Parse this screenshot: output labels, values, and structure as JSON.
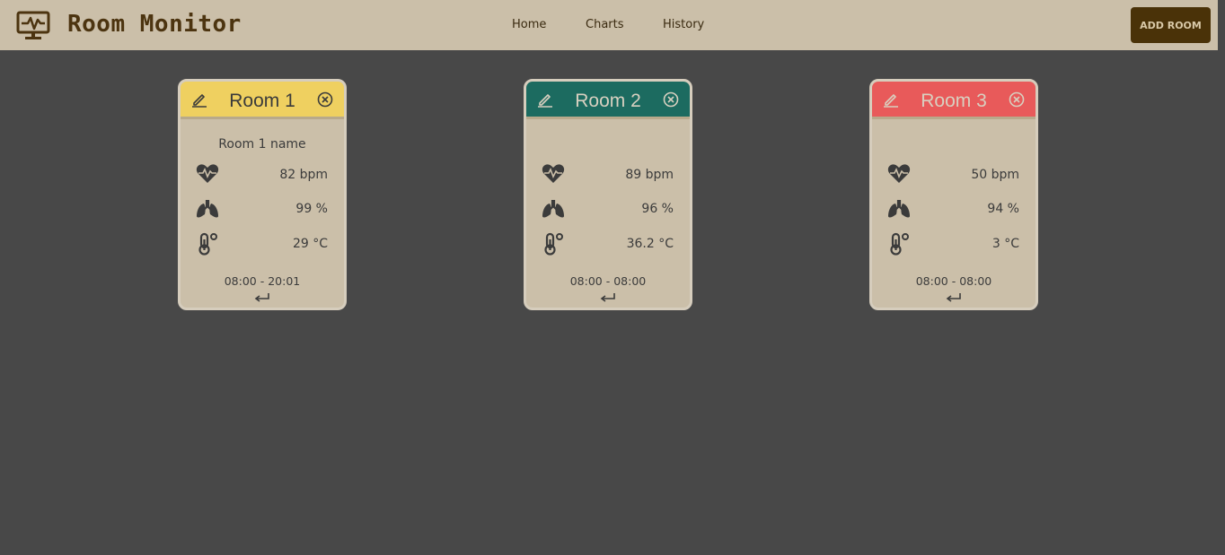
{
  "app": {
    "title": "Room Monitor",
    "logo_icon": "monitor-heartbeat-icon"
  },
  "nav": {
    "items": [
      "Home",
      "Charts",
      "History"
    ]
  },
  "header": {
    "add_room_label": "ADD ROOM"
  },
  "colors": {
    "header_bg": "#cbbfa9",
    "page_bg": "#484848",
    "brand": "#4c3410",
    "button_bg": "#4a3208",
    "room1": "#efd060",
    "room2": "#1c6b60",
    "room3": "#e85a5a"
  },
  "rooms": [
    {
      "title": "Room 1",
      "name": "Room 1 name",
      "heart_rate": "82 bpm",
      "oxygen": "99 %",
      "temperature": "29 °C",
      "time": "08:00 - 20:01"
    },
    {
      "title": "Room 2",
      "name": "",
      "heart_rate": "89 bpm",
      "oxygen": "96 %",
      "temperature": "36.2 °C",
      "time": "08:00 - 08:00"
    },
    {
      "title": "Room 3",
      "name": "",
      "heart_rate": "50 bpm",
      "oxygen": "94 %",
      "temperature": "3 °C",
      "time": "08:00 - 08:00"
    }
  ],
  "icons": {
    "edit": "pencil-icon",
    "close": "close-circle-icon",
    "heart": "heart-pulse-icon",
    "lungs": "lungs-icon",
    "temp": "thermometer-icon",
    "return": "return-arrow-icon"
  }
}
